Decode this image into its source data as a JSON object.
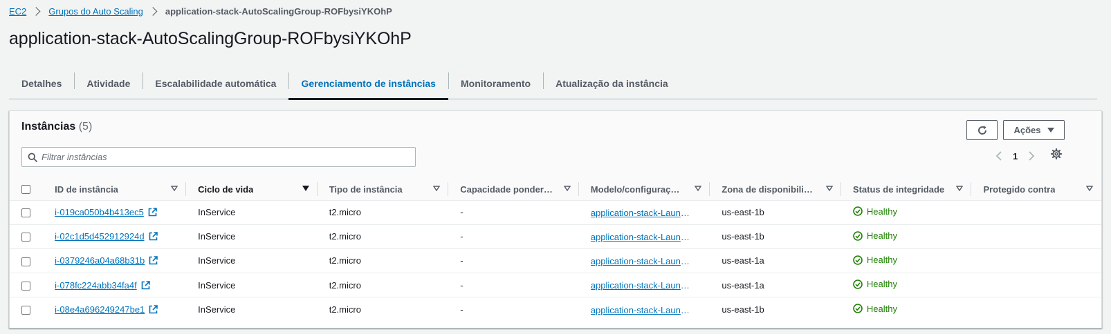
{
  "breadcrumb": {
    "items": [
      "EC2",
      "Grupos do Auto Scaling"
    ],
    "current": "application-stack-AutoScalingGroup-ROFbysiYKOhP"
  },
  "page_title": "application-stack-AutoScalingGroup-ROFbysiYKOhP",
  "tabs": [
    {
      "label": "Detalhes"
    },
    {
      "label": "Atividade"
    },
    {
      "label": "Escalabilidade automática"
    },
    {
      "label": "Gerenciamento de instâncias",
      "active": true
    },
    {
      "label": "Monitoramento"
    },
    {
      "label": "Atualização da instância"
    }
  ],
  "panel": {
    "title": "Instâncias",
    "count": "(5)",
    "actions_label": "Ações",
    "filter_placeholder": "Filtrar instâncias",
    "page": "1"
  },
  "table": {
    "columns": [
      "ID de instância",
      "Ciclo de vida",
      "Tipo de instância",
      "Capacidade ponderada",
      "Modelo/configuração de execução",
      "Zona de disponibilidade",
      "Status de integridade",
      "Protegido contra"
    ],
    "rows": [
      {
        "id": "i-019ca050b4b413ec5",
        "lifecycle": "InService",
        "type": "t2.micro",
        "weight": "-",
        "template": "application-stack-LaunchTemplate",
        "zone": "us-east-1b",
        "health": "Healthy",
        "protected": ""
      },
      {
        "id": "i-02c1d5d452912924d",
        "lifecycle": "InService",
        "type": "t2.micro",
        "weight": "-",
        "template": "application-stack-LaunchTemplate",
        "zone": "us-east-1b",
        "health": "Healthy",
        "protected": ""
      },
      {
        "id": "i-0379246a04a68b31b",
        "lifecycle": "InService",
        "type": "t2.micro",
        "weight": "-",
        "template": "application-stack-LaunchTemplate",
        "zone": "us-east-1a",
        "health": "Healthy",
        "protected": ""
      },
      {
        "id": "i-078fc224abb34fa4f",
        "lifecycle": "InService",
        "type": "t2.micro",
        "weight": "-",
        "template": "application-stack-LaunchTemplate",
        "zone": "us-east-1a",
        "health": "Healthy",
        "protected": ""
      },
      {
        "id": "i-08e4a696249247be1",
        "lifecycle": "InService",
        "type": "t2.micro",
        "weight": "-",
        "template": "application-stack-LaunchTemplate",
        "zone": "us-east-1b",
        "health": "Healthy",
        "protected": ""
      }
    ]
  },
  "colors": {
    "link": "#0073bb",
    "healthy": "#1d8102",
    "text": "#16191f",
    "muted": "#545b64"
  }
}
